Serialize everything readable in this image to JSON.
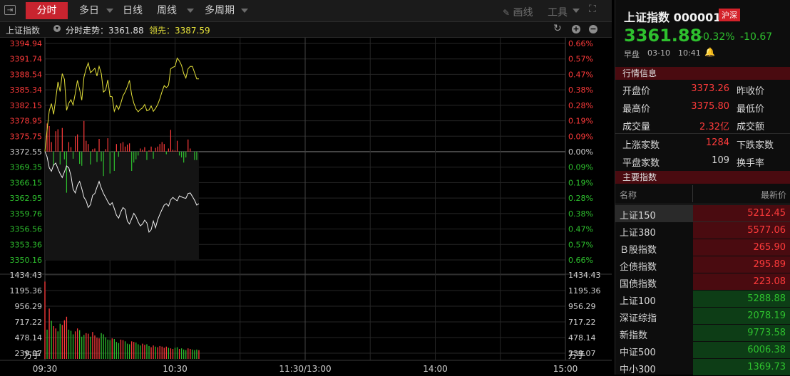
{
  "topbar": {
    "tabs": [
      "分时",
      "多日",
      "日线",
      "周线",
      "多周期"
    ],
    "draw_label": "画线",
    "tools_label": "工具"
  },
  "subbar": {
    "index_name": "上证指数",
    "intraday_label": "分时走势：3361.88",
    "lead_label": "领先：3387.59"
  },
  "chart": {
    "price_labels": [
      "3394.94",
      "3391.74",
      "3388.54",
      "3385.34",
      "3382.15",
      "3378.95",
      "3375.75",
      "3372.55",
      "3369.35",
      "3366.15",
      "3362.95",
      "3359.76",
      "3356.56",
      "3353.36",
      "3350.16"
    ],
    "pct_labels": [
      "0.66%",
      "0.57%",
      "0.47%",
      "0.38%",
      "0.28%",
      "0.19%",
      "0.09%",
      "0.00%",
      "0.09%",
      "0.19%",
      "0.28%",
      "0.38%",
      "0.47%",
      "0.57%",
      "0.66%"
    ],
    "vol_labels": [
      "1434.43",
      "1195.36",
      "956.29",
      "717.22",
      "478.14",
      "239.07"
    ],
    "vol_unit": "万手",
    "time_labels": [
      "09:30",
      "10:30",
      "11:30/13:00",
      "14:00",
      "15:00"
    ],
    "colors": {
      "up": "#ff3b3b",
      "down": "#2ec02e",
      "price": "#f0f0f0",
      "lead": "#e6e23a",
      "grid": "#2a2a2a",
      "zero": "#888888"
    }
  },
  "chart_data": {
    "type": "line",
    "prev_close": 3372.55,
    "ylim": [
      3350.16,
      3394.94
    ],
    "vol_ylim": [
      0,
      1434.43
    ],
    "minutes_shown": 72,
    "series": [
      {
        "name": "分时走势",
        "values": [
          3372.6,
          3371.5,
          3369.2,
          3368.5,
          3369.8,
          3370.2,
          3369.0,
          3368.0,
          3367.2,
          3368.4,
          3369.6,
          3369.2,
          3367.6,
          3364.8,
          3364.0,
          3365.6,
          3366.4,
          3364.9,
          3363.1,
          3362.4,
          3361.0,
          3361.6,
          3363.5,
          3363.9,
          3365.2,
          3366.4,
          3365.0,
          3363.9,
          3363.1,
          3362.2,
          3361.5,
          3362.0,
          3360.8,
          3359.4,
          3358.8,
          3360.1,
          3361.0,
          3360.6,
          3358.2,
          3357.6,
          3358.7,
          3359.8,
          3359.1,
          3358.0,
          3357.2,
          3357.6,
          3358.4,
          3357.8,
          3355.9,
          3356.4,
          3358.2,
          3356.8,
          3358.5,
          3359.6,
          3360.6,
          3361.5,
          3361.8,
          3361.3,
          3362.6,
          3363.1,
          3362.7,
          3362.4,
          3363.4,
          3363.2,
          3363.0,
          3362.9,
          3363.9,
          3364.0,
          3363.3,
          3362.5,
          3361.5,
          3361.8
        ]
      },
      {
        "name": "领先",
        "values": [
          3372.6,
          3377.0,
          3381.0,
          3382.5,
          3380.3,
          3383.5,
          3387.0,
          3385.0,
          3388.7,
          3387.5,
          3381.1,
          3382.6,
          3383.3,
          3382.2,
          3384.6,
          3387.3,
          3385.4,
          3383.2,
          3388.0,
          3389.7,
          3390.9,
          3388.9,
          3389.3,
          3389.8,
          3388.2,
          3390.2,
          3388.7,
          3384.9,
          3385.3,
          3387.4,
          3384.0,
          3383.9,
          3380.9,
          3382.1,
          3381.3,
          3382.6,
          3384.1,
          3384.9,
          3386.0,
          3387.3,
          3384.3,
          3382.6,
          3381.4,
          3380.8,
          3381.3,
          3381.6,
          3382.3,
          3381.0,
          3381.2,
          3382.0,
          3380.9,
          3381.5,
          3382.3,
          3383.5,
          3385.0,
          3386.2,
          3385.8,
          3386.3,
          3389.7,
          3390.0,
          3390.2,
          3391.9,
          3391.3,
          3390.4,
          3388.7,
          3387.8,
          3389.7,
          3390.2,
          3390.2,
          3388.9,
          3387.6,
          3387.6
        ]
      }
    ],
    "volumes": [
      1320,
      500,
      860,
      650,
      560,
      520,
      470,
      600,
      580,
      660,
      720,
      500,
      480,
      420,
      470,
      520,
      490,
      380,
      410,
      440,
      430,
      380,
      460,
      400,
      360,
      350,
      440,
      420,
      370,
      330,
      320,
      350,
      340,
      290,
      270,
      330,
      320,
      300,
      260,
      250,
      300,
      290,
      280,
      250,
      230,
      260,
      240,
      250,
      220,
      200,
      230,
      210,
      200,
      220,
      210,
      190,
      210,
      190,
      180,
      170,
      190,
      200,
      170,
      180,
      160,
      150,
      180,
      170,
      160,
      150,
      160,
      150
    ],
    "volume_up": [
      true,
      false,
      true,
      false,
      true,
      true,
      false,
      false,
      true,
      true,
      true,
      false,
      false,
      false,
      true,
      true,
      false,
      false,
      false,
      true,
      true,
      false,
      true,
      true,
      true,
      true,
      false,
      false,
      false,
      false,
      false,
      true,
      false,
      false,
      false,
      true,
      true,
      false,
      false,
      false,
      true,
      true,
      false,
      false,
      false,
      true,
      true,
      false,
      false,
      true,
      true,
      false,
      true,
      true,
      true,
      true,
      true,
      false,
      true,
      true,
      false,
      false,
      true,
      false,
      false,
      false,
      true,
      true,
      false,
      false,
      false,
      true
    ]
  },
  "quote": {
    "title": "上证指数 000001",
    "badge": "沪深",
    "price": "3361.88",
    "change_pct": "-0.32%",
    "change": "-10.67",
    "session": "早盘",
    "date": "03-10",
    "time": "10:41"
  },
  "market_info": {
    "header": "行情信息",
    "rows": [
      {
        "l1": "开盘价",
        "v1": "3373.26",
        "l2": "昨收价"
      },
      {
        "l1": "最高价",
        "v1": "3375.80",
        "l2": "最低价"
      },
      {
        "l1": "成交量",
        "v1": "2.32亿",
        "l2": "成交额"
      },
      {
        "l1": "上涨家数",
        "v1": "1284",
        "l2": "下跌家数"
      },
      {
        "l1": "平盘家数",
        "v1": "109",
        "l2": "换手率"
      }
    ]
  },
  "main_index": {
    "header": "主要指数",
    "col_name": "名称",
    "col_price": "最新价",
    "rows": [
      {
        "name": "上证150",
        "price": "5212.45",
        "dir": "up"
      },
      {
        "name": "上证380",
        "price": "5577.06",
        "dir": "up"
      },
      {
        "name": "Ｂ股指数",
        "price": "265.90",
        "dir": "up"
      },
      {
        "name": "企债指数",
        "price": "295.89",
        "dir": "up"
      },
      {
        "name": "国债指数",
        "price": "223.08",
        "dir": "up"
      },
      {
        "name": "上证100",
        "price": "5288.88",
        "dir": "down"
      },
      {
        "name": "深证综指",
        "price": "2078.19",
        "dir": "down"
      },
      {
        "name": "新指数",
        "price": "9773.58",
        "dir": "down"
      },
      {
        "name": "中证500",
        "price": "6006.38",
        "dir": "down"
      },
      {
        "name": "中小300",
        "price": "1369.73",
        "dir": "down"
      }
    ]
  }
}
